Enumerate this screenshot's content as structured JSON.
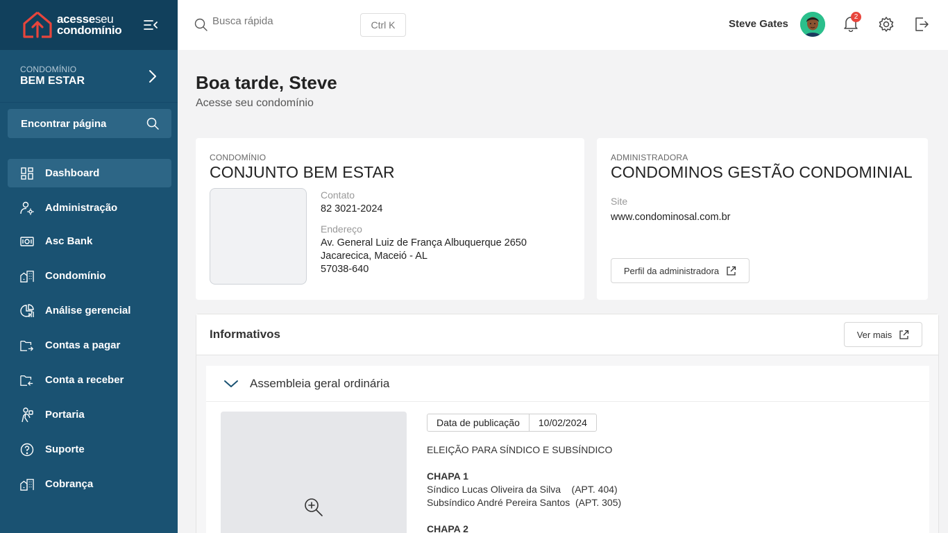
{
  "brand": {
    "line1_bold": "acesse",
    "line1_thin": "seu",
    "line2": "condomínio"
  },
  "sidebar": {
    "condo_label": "CONDOMÍNIO",
    "condo_name": "BEM ESTAR",
    "find_page": "Encontrar página",
    "items": [
      {
        "label": "Dashboard",
        "icon": "dashboard-icon",
        "active": true
      },
      {
        "label": "Administração",
        "icon": "admin-gear-icon"
      },
      {
        "label": "Asc Bank",
        "icon": "bank-icon"
      },
      {
        "label": "Condomínio",
        "icon": "building-icon"
      },
      {
        "label": "Análise gerencial",
        "icon": "analytics-icon"
      },
      {
        "label": "Contas a pagar",
        "icon": "payable-icon"
      },
      {
        "label": "Conta a receber",
        "icon": "receivable-icon"
      },
      {
        "label": "Portaria",
        "icon": "concierge-icon"
      },
      {
        "label": "Suporte",
        "icon": "help-icon"
      },
      {
        "label": "Cobrança",
        "icon": "billing-building-icon"
      }
    ]
  },
  "header": {
    "search_placeholder": "Busca rápida",
    "shortcut": "Ctrl K",
    "user_name": "Steve Gates",
    "notifications": "2"
  },
  "main": {
    "greeting": "Boa tarde, Steve",
    "subtitle": "Acesse seu condomínio",
    "condo_card": {
      "label": "CONDOMÍNIO",
      "name": "CONJUNTO BEM ESTAR",
      "contact_label": "Contato",
      "contact": "82 3021-2024",
      "address_label": "Endereço",
      "address_line1": "Av. General Luiz de França Albuquerque 2650",
      "address_line2": "Jacarecica, Maceió - AL",
      "address_line3": "57038-640"
    },
    "admin_card": {
      "label": "ADMINISTRADORA",
      "name": "CONDOMINOS GESTÃO CONDOMINIAL",
      "site_label": "Site",
      "site": "www.condominosal.com.br",
      "profile_button": "Perfil da administradora"
    },
    "informativos": {
      "title": "Informativos",
      "more_button": "Ver mais",
      "item": {
        "title": "Assembleia geral ordinária",
        "pub_label": "Data de publicação",
        "pub_date": "10/02/2024",
        "headline": "ELEIÇÃO PARA SÍNDICO E SUBSÍNDICO",
        "chapa1_title": "CHAPA 1",
        "chapa1_line1": "Síndico Lucas Oliveira da Silva    (APT. 404)",
        "chapa1_line2": "Subsíndico André Pereira Santos  (APT. 305)",
        "chapa2_title": "CHAPA 2"
      }
    }
  }
}
